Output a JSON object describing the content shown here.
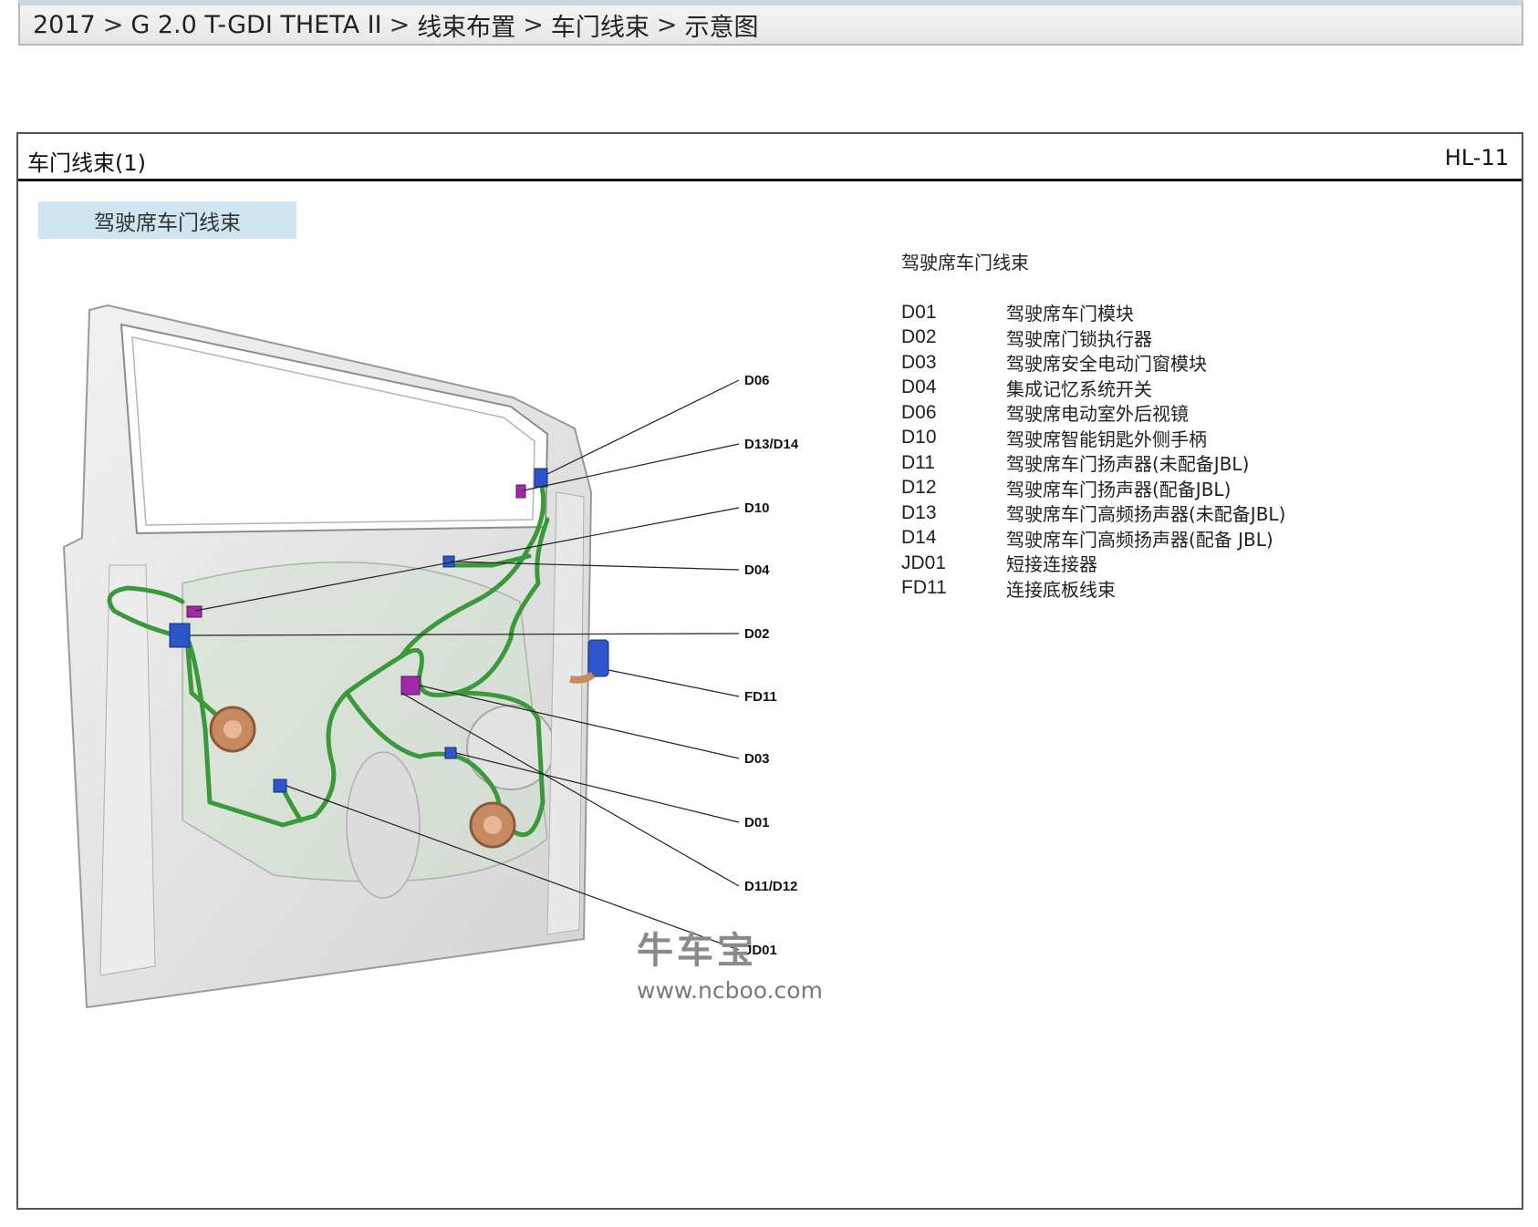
{
  "breadcrumb": {
    "items": [
      "2017",
      "G 2.0 T-GDI THETA II",
      "线束布置",
      "车门线束",
      "示意图"
    ],
    "separator": ">"
  },
  "panel": {
    "title": "车门线束(1)",
    "code": "HL-11",
    "section_tab": "驾驶席车门线束"
  },
  "callouts": [
    "D06",
    "D13/D14",
    "D10",
    "D04",
    "D02",
    "FD11",
    "D03",
    "D01",
    "D11/D12",
    "JD01"
  ],
  "legend": {
    "title": "驾驶席车门线束",
    "items": [
      {
        "code": "D01",
        "desc": "驾驶席车门模块"
      },
      {
        "code": "D02",
        "desc": "驾驶席门锁执行器"
      },
      {
        "code": "D03",
        "desc": "驾驶席安全电动门窗模块"
      },
      {
        "code": "D04",
        "desc": "集成记忆系统开关"
      },
      {
        "code": "D06",
        "desc": "驾驶席电动室外后视镜"
      },
      {
        "code": "D10",
        "desc": "驾驶席智能钥匙外侧手柄"
      },
      {
        "code": "D11",
        "desc": "驾驶席车门扬声器(未配备JBL)"
      },
      {
        "code": "D12",
        "desc": "驾驶席车门扬声器(配备JBL)"
      },
      {
        "code": "D13",
        "desc": "驾驶席车门高频扬声器(未配备JBL)"
      },
      {
        "code": "D14",
        "desc": "驾驶席车门高频扬声器(配备 JBL)"
      },
      {
        "code": "JD01",
        "desc": "短接连接器"
      },
      {
        "code": "FD11",
        "desc": "连接底板线束"
      }
    ]
  },
  "watermark": {
    "brand": "牛车宝",
    "url": "www.ncboo.com"
  },
  "colors": {
    "harness": "#3a9a3a",
    "connector_blue": "#2b55c8",
    "connector_magenta": "#a02aa8",
    "speaker": "#c88a60",
    "tab_bg": "#cfe6f1"
  }
}
